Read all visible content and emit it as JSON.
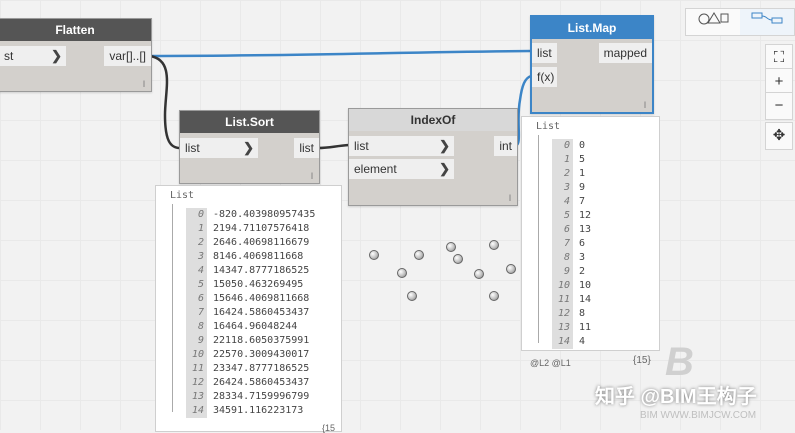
{
  "toolbar": {
    "geometry_icon": "geometry-view-icon",
    "graph_icon": "graph-view-icon"
  },
  "zoom": {
    "fit": "⛶",
    "zoom_in": "+",
    "zoom_out": "−",
    "pan": "✥"
  },
  "flatten": {
    "title": "Flatten",
    "input": "st",
    "output": "var[]..[]",
    "lacing": "l"
  },
  "sort": {
    "title": "List.Sort",
    "input": "list",
    "output": "list",
    "lacing": "l"
  },
  "indexof": {
    "title": "IndexOf",
    "inputs": [
      "list",
      "element"
    ],
    "output": "int",
    "lacing": "l"
  },
  "listmap": {
    "title": "List.Map",
    "inputs": [
      "list",
      "f(x)"
    ],
    "output": "mapped",
    "lacing": "l"
  },
  "sort_watch": {
    "title": "List",
    "rows": [
      {
        "i": "0",
        "v": "-820.403980957435"
      },
      {
        "i": "1",
        "v": "2194.71107576418"
      },
      {
        "i": "2",
        "v": "2646.40698116679"
      },
      {
        "i": "3",
        "v": "8146.4069811668"
      },
      {
        "i": "4",
        "v": "14347.8777186525"
      },
      {
        "i": "5",
        "v": "15050.463269495"
      },
      {
        "i": "6",
        "v": "15646.4069811668"
      },
      {
        "i": "7",
        "v": "16424.5860453437"
      },
      {
        "i": "8",
        "v": "16464.96048244"
      },
      {
        "i": "9",
        "v": "22118.6050375991"
      },
      {
        "i": "10",
        "v": "22570.3009430017"
      },
      {
        "i": "11",
        "v": "23347.8777186525"
      },
      {
        "i": "12",
        "v": "26424.5860453437"
      },
      {
        "i": "13",
        "v": "28334.7159996799"
      },
      {
        "i": "14",
        "v": "34591.116223173"
      }
    ],
    "count": "{15"
  },
  "map_watch": {
    "title": "List",
    "rows": [
      {
        "i": "0",
        "v": "0"
      },
      {
        "i": "1",
        "v": "5"
      },
      {
        "i": "2",
        "v": "1"
      },
      {
        "i": "3",
        "v": "9"
      },
      {
        "i": "4",
        "v": "7"
      },
      {
        "i": "5",
        "v": "12"
      },
      {
        "i": "6",
        "v": "13"
      },
      {
        "i": "7",
        "v": "6"
      },
      {
        "i": "8",
        "v": "3"
      },
      {
        "i": "9",
        "v": "2"
      },
      {
        "i": "10",
        "v": "10"
      },
      {
        "i": "11",
        "v": "14"
      },
      {
        "i": "12",
        "v": "8"
      },
      {
        "i": "13",
        "v": "11"
      },
      {
        "i": "14",
        "v": "4"
      }
    ],
    "levels": "@L2 @L1",
    "count": "{15}"
  },
  "watermark": {
    "text": "知乎 @BIM王构子",
    "url": "BIM WWW.BIMJCW.COM",
    "logo": "B"
  },
  "colors": {
    "wire_blue": "#3c85c7",
    "wire_dark": "#333333",
    "header": "#555555"
  }
}
